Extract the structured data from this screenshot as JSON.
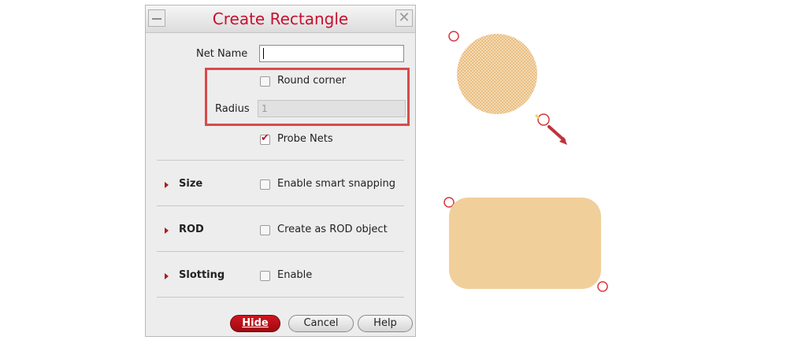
{
  "dialog": {
    "title": "Create Rectangle",
    "net_name_label": "Net Name",
    "net_name_value": "",
    "round_corner_label": "Round corner",
    "round_corner_checked": false,
    "radius_label": "Radius",
    "radius_value": "1",
    "probe_nets_label": "Probe Nets",
    "probe_nets_checked": true,
    "sections": [
      {
        "name": "Size",
        "option_label": "Enable smart snapping",
        "checked": false
      },
      {
        "name": "ROD",
        "option_label": "Create as ROD object",
        "checked": false
      },
      {
        "name": "Slotting",
        "option_label": "Enable",
        "checked": false
      }
    ],
    "buttons": {
      "hide": "Hide",
      "cancel": "Cancel",
      "help": "Help"
    },
    "close_glyph": "✕"
  },
  "colors": {
    "title": "#c8102e",
    "highlight": "#d94a4a",
    "shape_fill": "#f1cf9a",
    "marker": "#d9373f"
  },
  "icons": [
    "minimize-icon",
    "close-icon",
    "expand-triangle-icon",
    "checkmark-icon",
    "drag-arrow-icon"
  ]
}
